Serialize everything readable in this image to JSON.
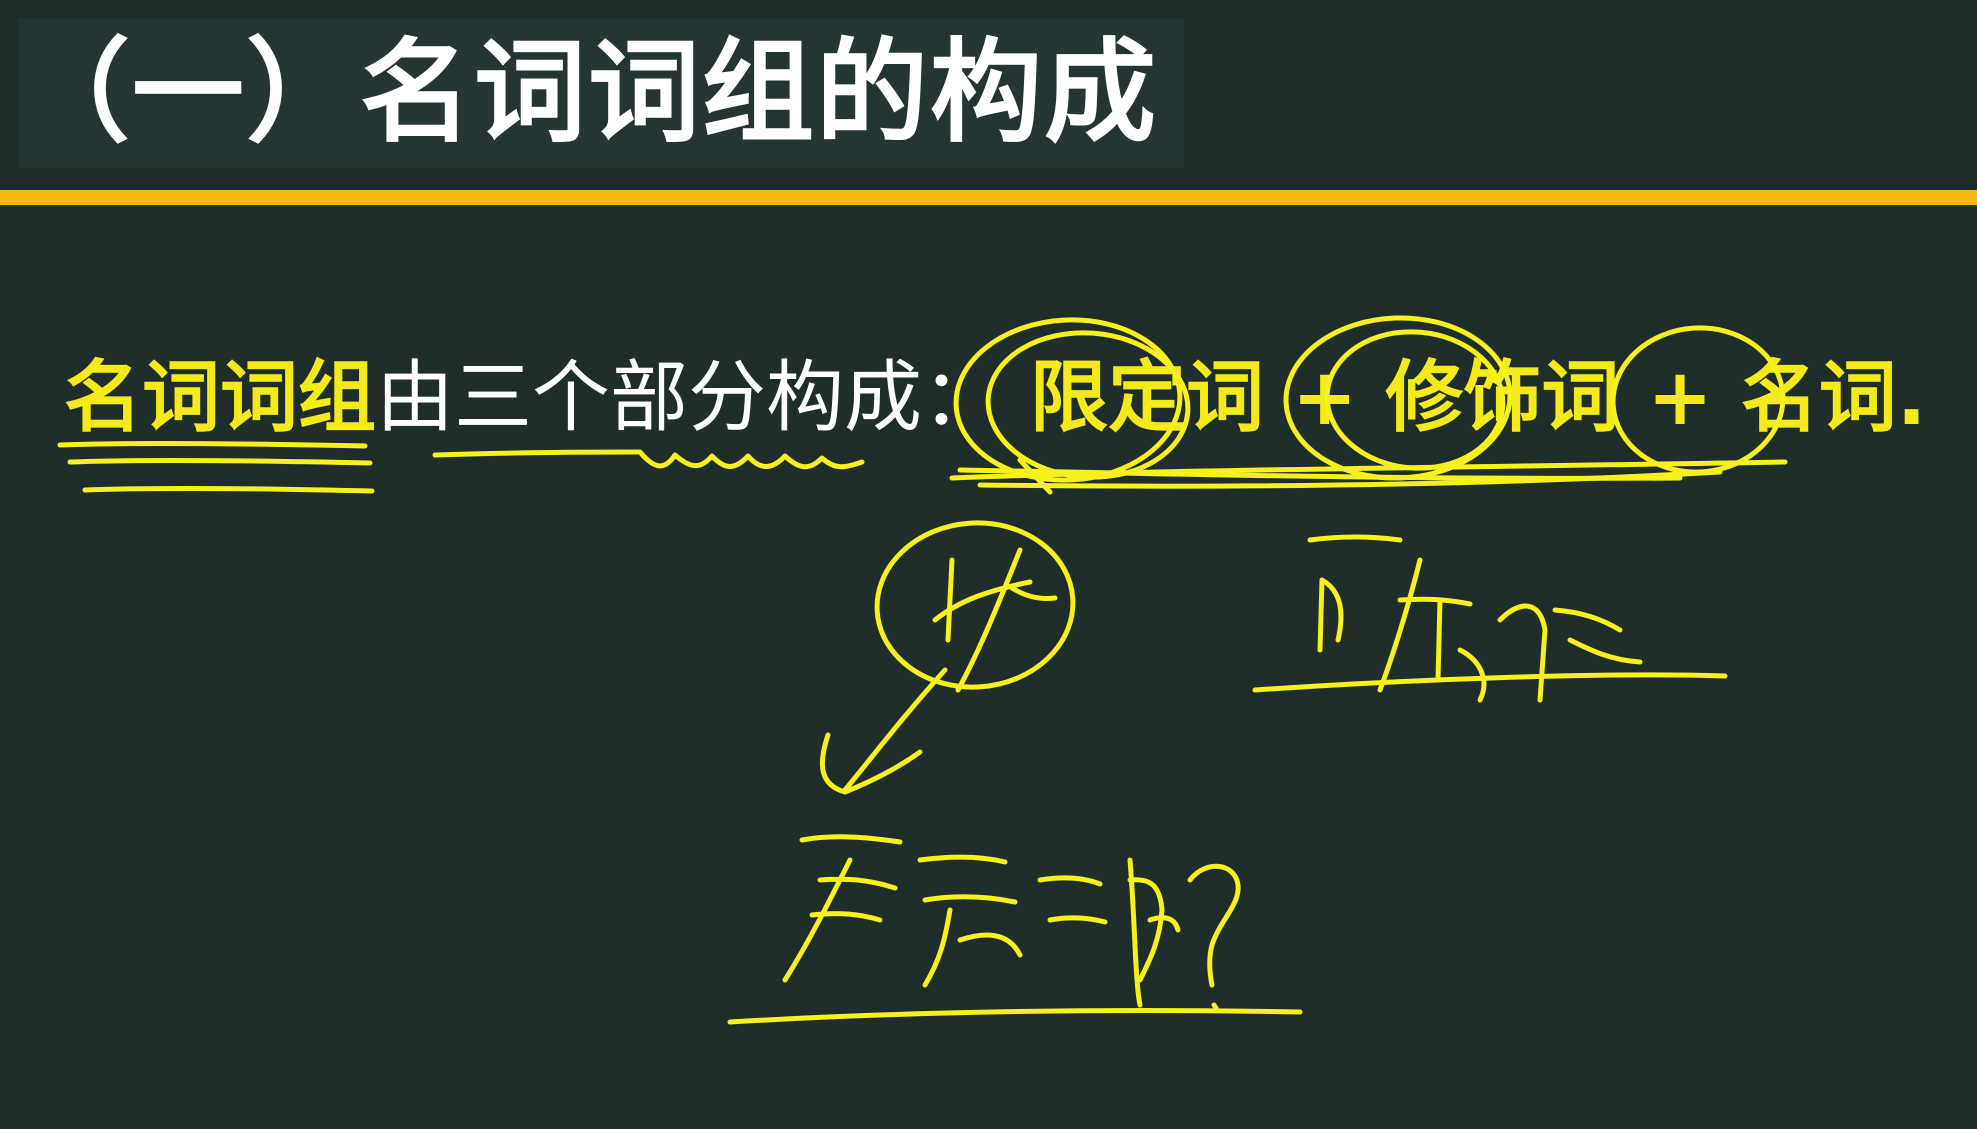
{
  "slide": {
    "title": "（一）名词词组的构成",
    "definition": {
      "subject": "名词词组",
      "predicate": "由三个部分构成：",
      "components": [
        "限定词",
        "修饰词",
        "名词"
      ],
      "plus": "+",
      "end": "."
    }
  },
  "colors": {
    "background": "#1f2d2b",
    "title_text": "#ffffff",
    "accent_rule": "#f6b915",
    "highlight_text": "#f2ea1a",
    "ink": "#f5f01e"
  }
}
